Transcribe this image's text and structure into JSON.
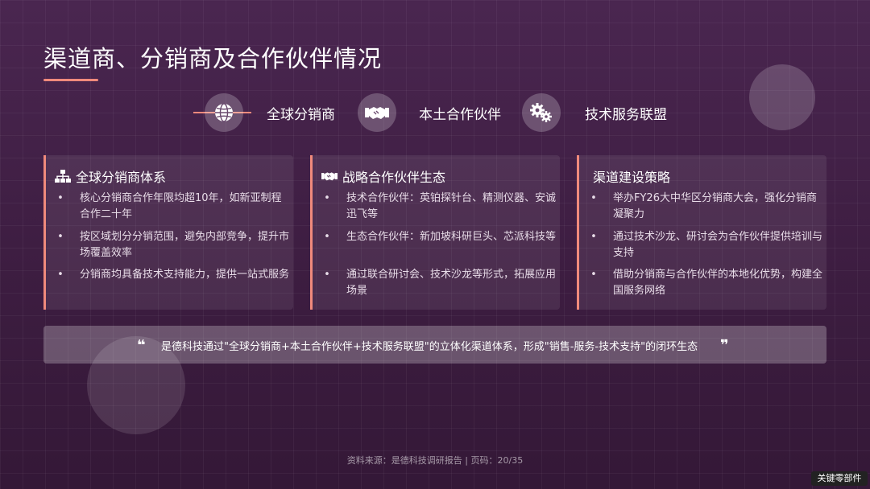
{
  "page": {
    "title": "渠道商、分销商及合作伙伴情况",
    "accent_color": "#f08a7c"
  },
  "categories": [
    {
      "icon": "globe-icon",
      "label": "全球分销商"
    },
    {
      "icon": "handshake-icon",
      "label": "本土合作伙伴"
    },
    {
      "icon": "gears-icon",
      "label": "技术服务联盟"
    }
  ],
  "cards": [
    {
      "icon": "sitemap-icon",
      "title": "全球分销商体系",
      "bullets": [
        "核心分销商合作年限均超10年，如新亚制程合作二十年",
        "按区域划分分销范围，避免内部竞争，提升市场覆盖效率",
        "分销商均具备技术支持能力，提供一站式服务"
      ]
    },
    {
      "icon": "handshake-icon",
      "title": "战略合作伙伴生态",
      "bullets": [
        "技术合作伙伴：英铂探针台、精测仪器、安诚迅飞等",
        "生态合作伙伴：新加坡科研巨头、芯派科技等",
        "通过联合研讨会、技术沙龙等形式，拓展应用场景"
      ]
    },
    {
      "icon": "",
      "title": "渠道建设策略",
      "bullets": [
        "举办FY26大中华区分销商大会，强化分销商凝聚力",
        "通过技术沙龙、研讨会为合作伙伴提供培训与支持",
        "借助分销商与合作伙伴的本地化优势，构建全国服务网络"
      ]
    }
  ],
  "quote": {
    "open_mark": "❝",
    "text": "是德科技通过\"全球分销商+本土合作伙伴+技术服务联盟\"的立体化渠道体系，形成\"销售-服务-技术支持\"的闭环生态",
    "close_mark": "❞"
  },
  "footer": "资料来源：是德科技调研报告 | 页码：20/35",
  "badge": "关键零部件"
}
